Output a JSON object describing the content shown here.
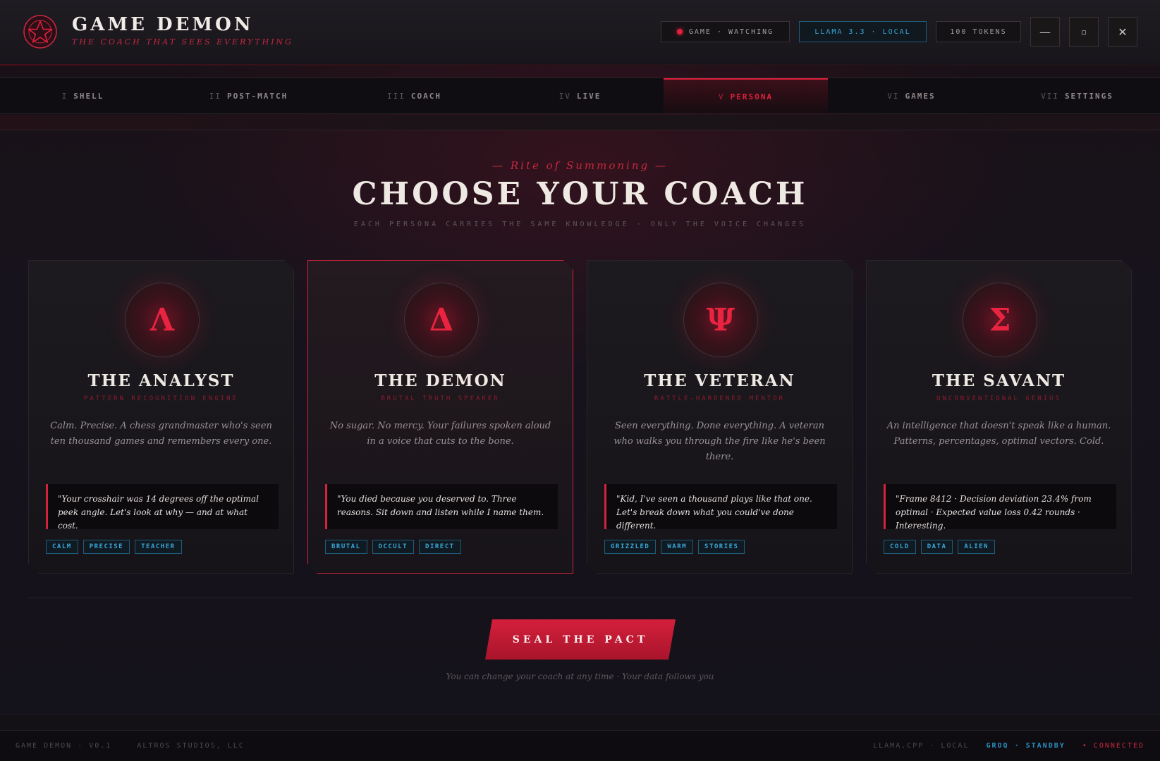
{
  "header": {
    "title": "GAME DEMON",
    "tagline": "THE COACH THAT SEES EVERYTHING",
    "status_game": "GAME · WATCHING",
    "status_model": "LLAMA 3.3 · LOCAL",
    "status_tokens": "100 TOKENS",
    "minimize_label": "—",
    "maximize_label": "▫",
    "close_label": "✕"
  },
  "tabs": [
    {
      "num": "I",
      "label": "SHELL"
    },
    {
      "num": "II",
      "label": "POST-MATCH"
    },
    {
      "num": "III",
      "label": "COACH"
    },
    {
      "num": "IV",
      "label": "LIVE"
    },
    {
      "num": "V",
      "label": "PERSONA"
    },
    {
      "num": "VI",
      "label": "GAMES"
    },
    {
      "num": "VII",
      "label": "SETTINGS"
    }
  ],
  "active_tab": 4,
  "hero": {
    "eyebrow": "— Rite of Summoning —",
    "title": "CHOOSE YOUR COACH",
    "subtitle": "EACH PERSONA CARRIES THE SAME KNOWLEDGE · ONLY THE VOICE CHANGES"
  },
  "personas": [
    {
      "sigil": "Λ",
      "name": "THE ANALYST",
      "role": "PATTERN RECOGNITION ENGINE",
      "description": "Calm. Precise. A chess grandmaster who's seen ten thousand games and remembers every one.",
      "quote": "\"Your crosshair was 14 degrees off the optimal peek angle. Let's look at why — and at what cost.",
      "tags": [
        "CALM",
        "PRECISE",
        "TEACHER"
      ]
    },
    {
      "sigil": "Δ",
      "name": "THE DEMON",
      "role": "BRUTAL TRUTH SPEAKER",
      "description": "No sugar. No mercy. Your failures spoken aloud in a voice that cuts to the bone.",
      "quote": "\"You died because you deserved to. Three reasons. Sit down and listen while I name them.",
      "tags": [
        "BRUTAL",
        "OCCULT",
        "DIRECT"
      ]
    },
    {
      "sigil": "Ψ",
      "name": "THE VETERAN",
      "role": "BATTLE-HARDENED MENTOR",
      "description": "Seen everything. Done everything. A veteran who walks you through the fire like he's been there.",
      "quote": "\"Kid, I've seen a thousand plays like that one. Let's break down what you could've done different.",
      "tags": [
        "GRIZZLED",
        "WARM",
        "STORIES"
      ]
    },
    {
      "sigil": "Σ",
      "name": "THE SAVANT",
      "role": "UNCONVENTIONAL GENIUS",
      "description": "An intelligence that doesn't speak like a human. Patterns, percentages, optimal vectors. Cold.",
      "quote": "\"Frame 8412 · Decision deviation 23.4% from optimal · Expected value loss 0.42 rounds · Interesting.",
      "tags": [
        "COLD",
        "DATA",
        "ALIEN"
      ]
    }
  ],
  "selected_persona": 1,
  "cta": {
    "label": "SEAL THE PACT",
    "note": "You can change your coach at any time · Your data follows you"
  },
  "footer": {
    "app": "GAME DEMON · V0.1",
    "studio": "ALTROS STUDIOS, LLC",
    "engine": "LLAMA.CPP · LOCAL",
    "groq": "GROQ · STANDBY",
    "connection": "• CONNECTED"
  },
  "colors": {
    "accent": "#e0203c",
    "tag_blue": "#3aa6d8",
    "background": "#14121a"
  }
}
